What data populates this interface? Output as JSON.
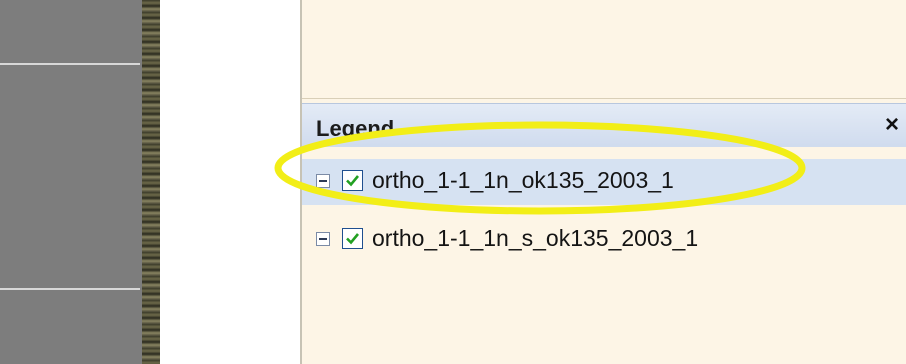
{
  "legend": {
    "title": "Legend",
    "close_label": "×",
    "layers": [
      {
        "name": "ortho_1-1_1n_ok135_2003_1",
        "checked": true,
        "selected": true
      },
      {
        "name": "ortho_1-1_1n_s_ok135_2003_1",
        "checked": true,
        "selected": false
      }
    ]
  },
  "colors": {
    "highlight": "#f2ee17",
    "dock_background": "#fdf5e6",
    "header": "#d6e2f2"
  },
  "icons": {
    "expander": "minus-box-icon",
    "checkbox": "checkmark-icon",
    "close": "close-icon"
  }
}
